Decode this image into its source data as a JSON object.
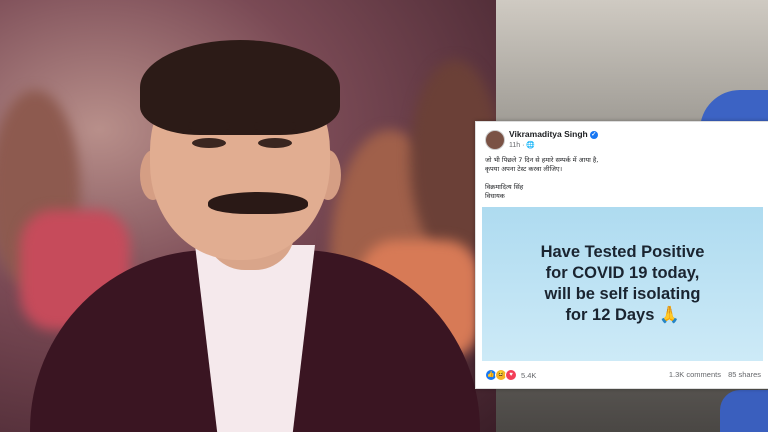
{
  "post": {
    "author": "Vikramaditya Singh",
    "time": "11h",
    "body_line1": "जो भी पिछले 7 दिन से हमारे सम्पर्क में आया है,",
    "body_line2": "कृपया अपना टेस्ट करवा लीजिए।",
    "signature_name": "विक्रमादित्य सिंह",
    "signature_title": "विधायक",
    "banner_line1": "Have Tested Positive",
    "banner_line2": "for COVID 19 today,",
    "banner_line3": "will be self isolating",
    "banner_line4": "for 12 Days 🙏",
    "reaction_count": "5.4K",
    "comments": "1.3K comments",
    "shares": "85 shares"
  },
  "icons": [
    "verified-badge-icon",
    "like-reaction-icon",
    "haha-reaction-icon",
    "love-reaction-icon",
    "globe-icon"
  ],
  "colors": {
    "accent": "#1877f2",
    "banner": "#bfe3f4",
    "suit": "#3a1522"
  }
}
